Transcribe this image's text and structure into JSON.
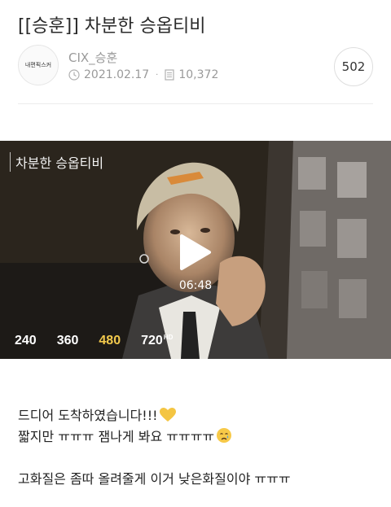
{
  "post": {
    "title": "[[승훈]] 차분한 승옵티비",
    "author": "CIX_승훈",
    "avatar_text": "내편픽스커",
    "date": "2021.02.17",
    "views": "10,372",
    "comment_count": "502"
  },
  "video": {
    "title": "차분한 승옵티비",
    "duration": "06:48",
    "qualities": [
      {
        "label": "240",
        "hd": ""
      },
      {
        "label": "360",
        "hd": ""
      },
      {
        "label": "480",
        "hd": ""
      },
      {
        "label": "720",
        "hd": "HD"
      }
    ],
    "selected_quality": "480",
    "active_color": "#f2c94c"
  },
  "body": {
    "line1": "드디어 도착하였습니다!!!",
    "line1_emoji": "yellow-heart-icon",
    "line2": "짧지만 ㅠㅠㅠ 잼나게 봐요 ㅠㅠㅠㅠ",
    "line2_emoji": "crying-face-icon",
    "line3": "고화질은 좀따 올려줄게 이거 낮은화질이야 ㅠㅠㅠ"
  }
}
